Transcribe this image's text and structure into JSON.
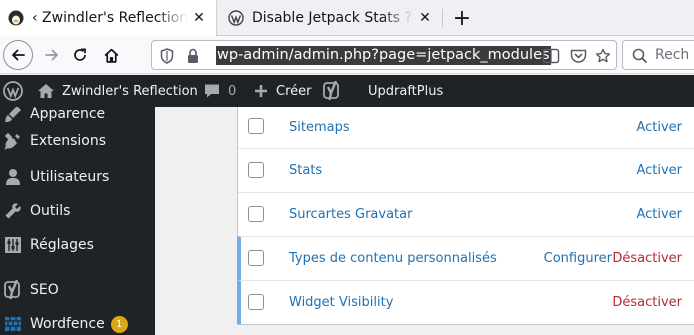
{
  "browser": {
    "tabs": [
      {
        "title": "‹ Zwindler's Reflection — W",
        "active": true
      },
      {
        "title": "Disable Jetpack Stats ? No",
        "active": false
      }
    ],
    "url": "wp-admin/admin.php?page=jetpack_modules",
    "search_placeholder": "Rech"
  },
  "adminbar": {
    "site_name": "Zwindler's Reflection",
    "comments_count": "0",
    "new_label": "Créer",
    "updraft_label": "UpdraftPlus"
  },
  "sidebar": {
    "items": [
      {
        "label": "Apparence",
        "icon": "brush-icon"
      },
      {
        "label": "Extensions",
        "icon": "plugin-icon"
      },
      {
        "label": "Utilisateurs",
        "icon": "users-icon"
      },
      {
        "label": "Outils",
        "icon": "wrench-icon"
      },
      {
        "label": "Réglages",
        "icon": "settings-icon"
      },
      {
        "label": "SEO",
        "icon": "yoast-icon"
      },
      {
        "label": "Wordfence",
        "icon": "wordfence-icon",
        "badge": "1"
      }
    ]
  },
  "modules": [
    {
      "name": "Sitemaps",
      "actions": [
        "Activer"
      ],
      "active": false
    },
    {
      "name": "Stats",
      "actions": [
        "Activer"
      ],
      "active": false
    },
    {
      "name": "Surcartes Gravatar",
      "actions": [
        "Activer"
      ],
      "active": false
    },
    {
      "name": "Types de contenu personnalisés",
      "actions": [
        "Configurer",
        "Désactiver"
      ],
      "active": true
    },
    {
      "name": "Widget Visibility",
      "actions": [
        "Désactiver"
      ],
      "active": true
    }
  ],
  "colors": {
    "admin_dark": "#1d2327",
    "link_blue": "#2271b1",
    "deactivate_red": "#b32d2e",
    "active_border": "#72aee6",
    "badge": "#dba617"
  }
}
